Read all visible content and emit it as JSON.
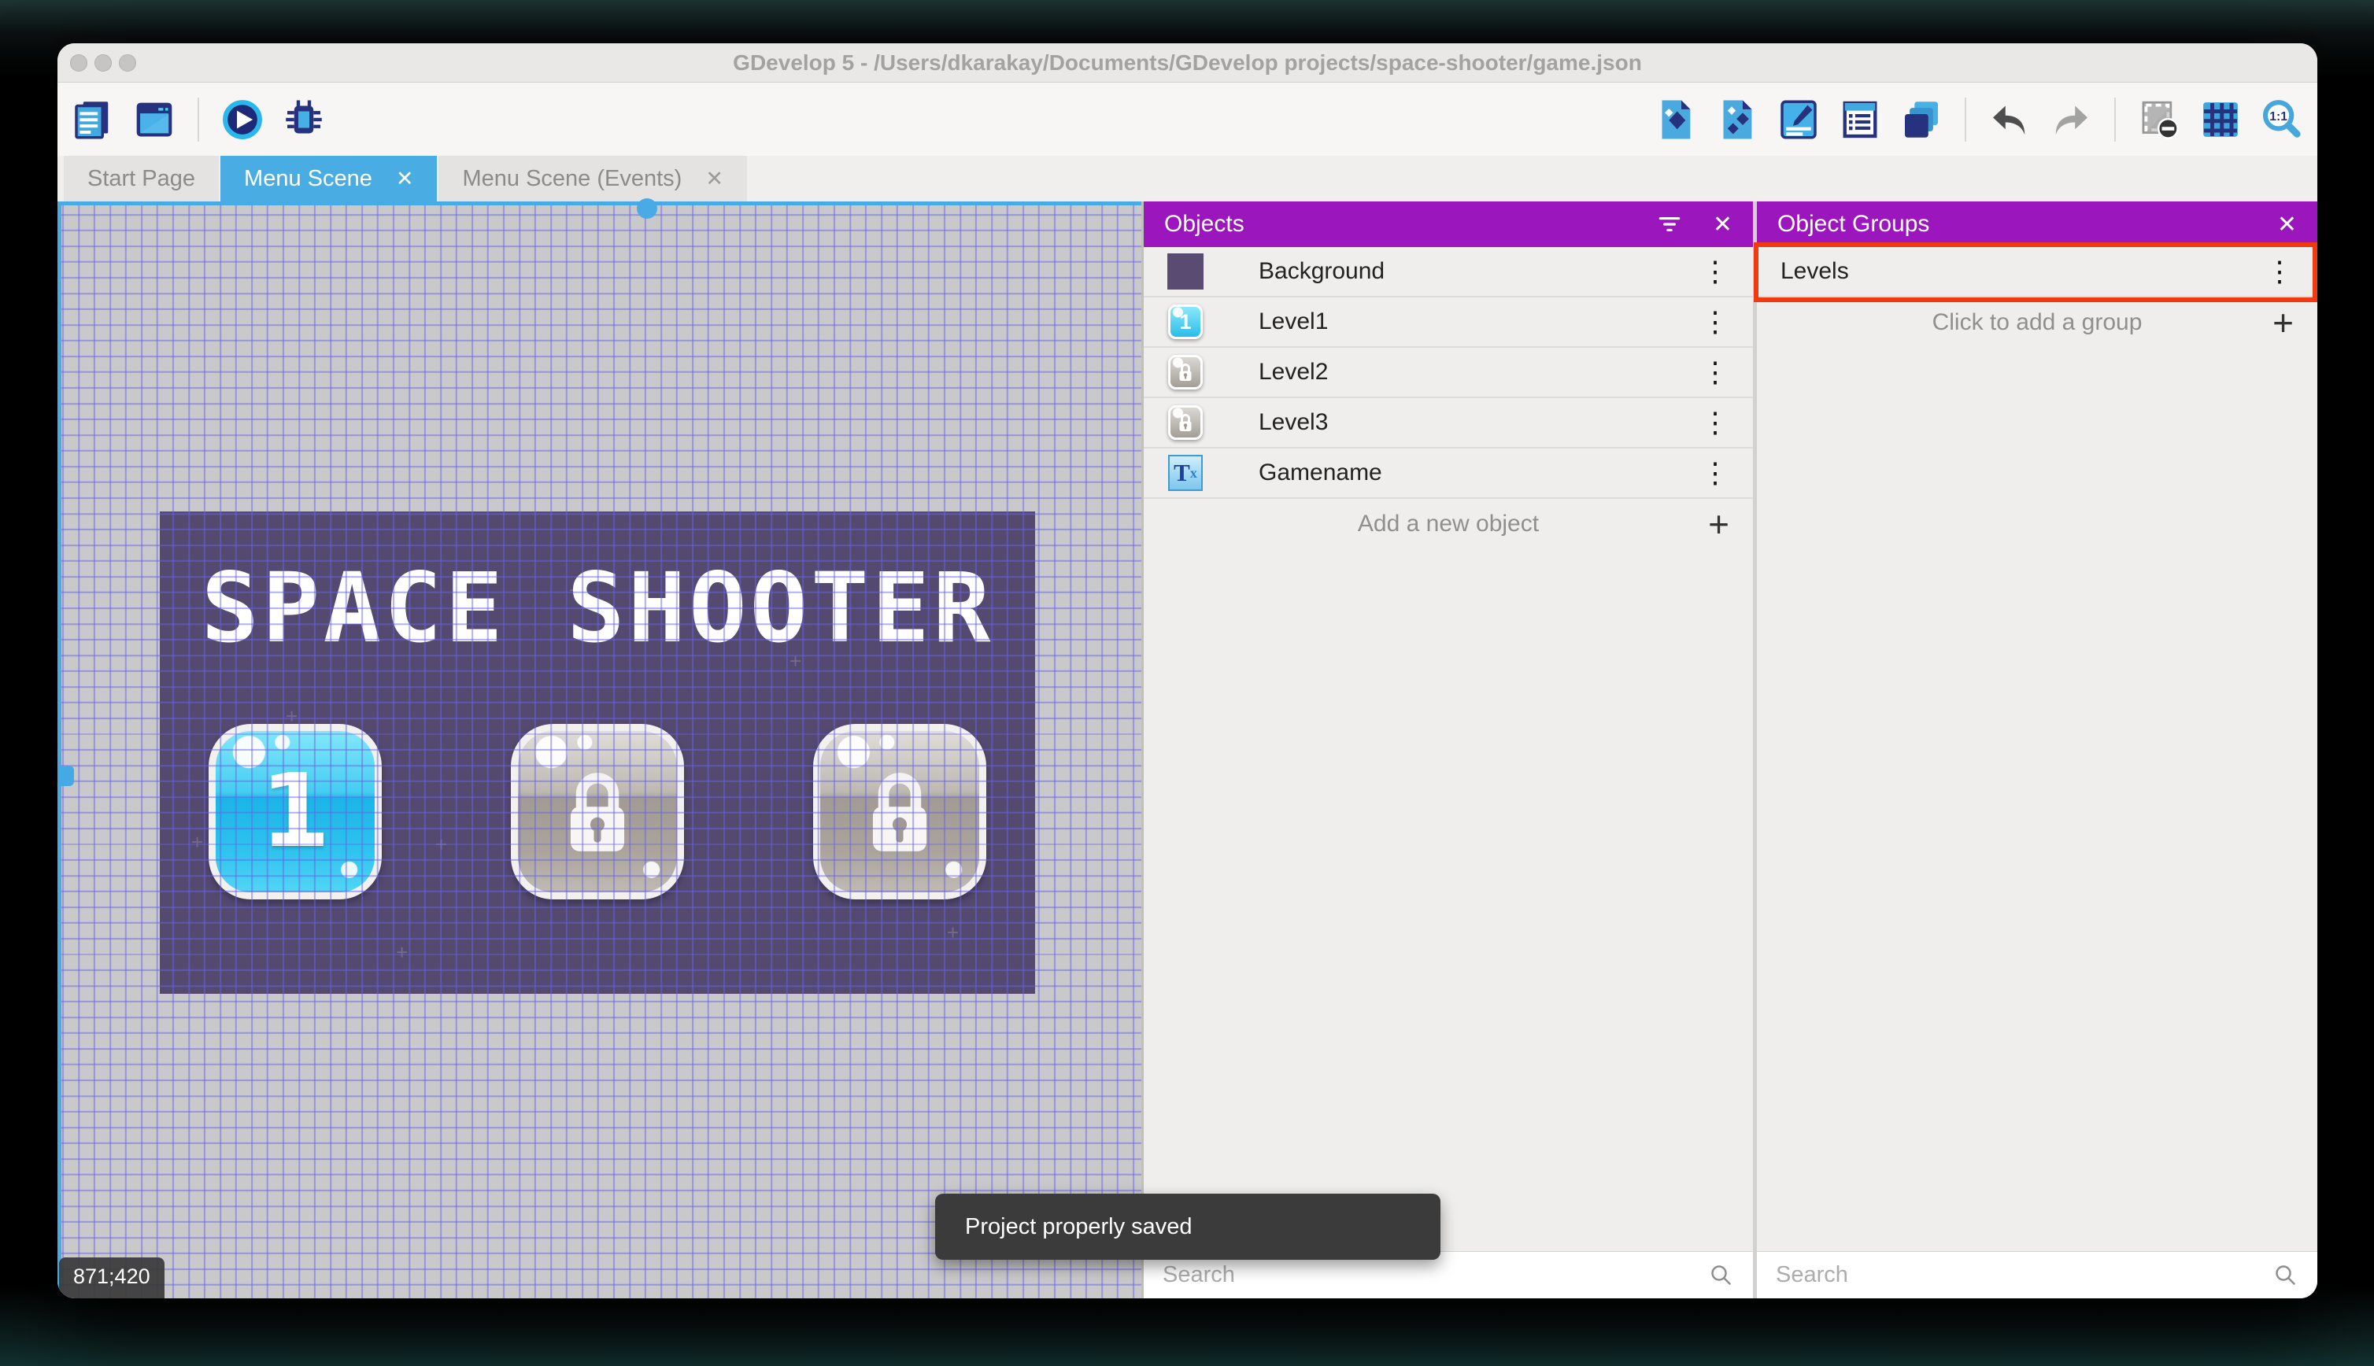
{
  "window": {
    "title": "GDevelop 5 - /Users/dkarakay/Documents/GDevelop projects/space-shooter/game.json"
  },
  "toolbar": {
    "left_icons": [
      "project-manager-icon",
      "scene-editor-icon",
      "play-icon",
      "debug-icon"
    ],
    "right_icons": [
      "objects-icon",
      "object-groups-icon",
      "properties-icon",
      "instances-list-icon",
      "layers-icon",
      "undo-icon",
      "redo-icon",
      "mask-icon",
      "grid-icon",
      "zoom-1-1-icon"
    ]
  },
  "tabs": [
    {
      "label": "Start Page",
      "active": false,
      "closable": false
    },
    {
      "label": "Menu Scene",
      "active": true,
      "closable": true
    },
    {
      "label": "Menu Scene (Events)",
      "active": false,
      "closable": true
    }
  ],
  "canvas": {
    "coordinates": "871;420",
    "game": {
      "title": "SPACE SHOOTER",
      "buttons": [
        {
          "label": "1",
          "locked": false
        },
        {
          "label": "",
          "locked": true
        },
        {
          "label": "",
          "locked": true
        }
      ]
    }
  },
  "objects_panel": {
    "title": "Objects",
    "items": [
      {
        "name": "Background",
        "icon": "background-thumbnail"
      },
      {
        "name": "Level1",
        "icon": "level1-button-thumbnail"
      },
      {
        "name": "Level2",
        "icon": "locked-button-thumbnail"
      },
      {
        "name": "Level3",
        "icon": "locked-button-thumbnail"
      },
      {
        "name": "Gamename",
        "icon": "text-object-thumbnail"
      }
    ],
    "add_label": "Add a new object",
    "search_placeholder": "Search"
  },
  "groups_panel": {
    "title": "Object Groups",
    "items": [
      {
        "name": "Levels",
        "highlighted": true
      }
    ],
    "add_label": "Click to add a group",
    "search_placeholder": "Search"
  },
  "toast": {
    "message": "Project properly saved"
  },
  "glyphs": {
    "close": "✕",
    "kebab": "⋮",
    "plus": "+",
    "star": "+"
  },
  "colors": {
    "accent_blue": "#49ade4",
    "panel_header_purple": "#9b16bd",
    "annotation_red": "#f23a12",
    "game_background": "#544a70",
    "grid_line": "#6861e8",
    "scrollbar_blue": "#49abe6"
  }
}
